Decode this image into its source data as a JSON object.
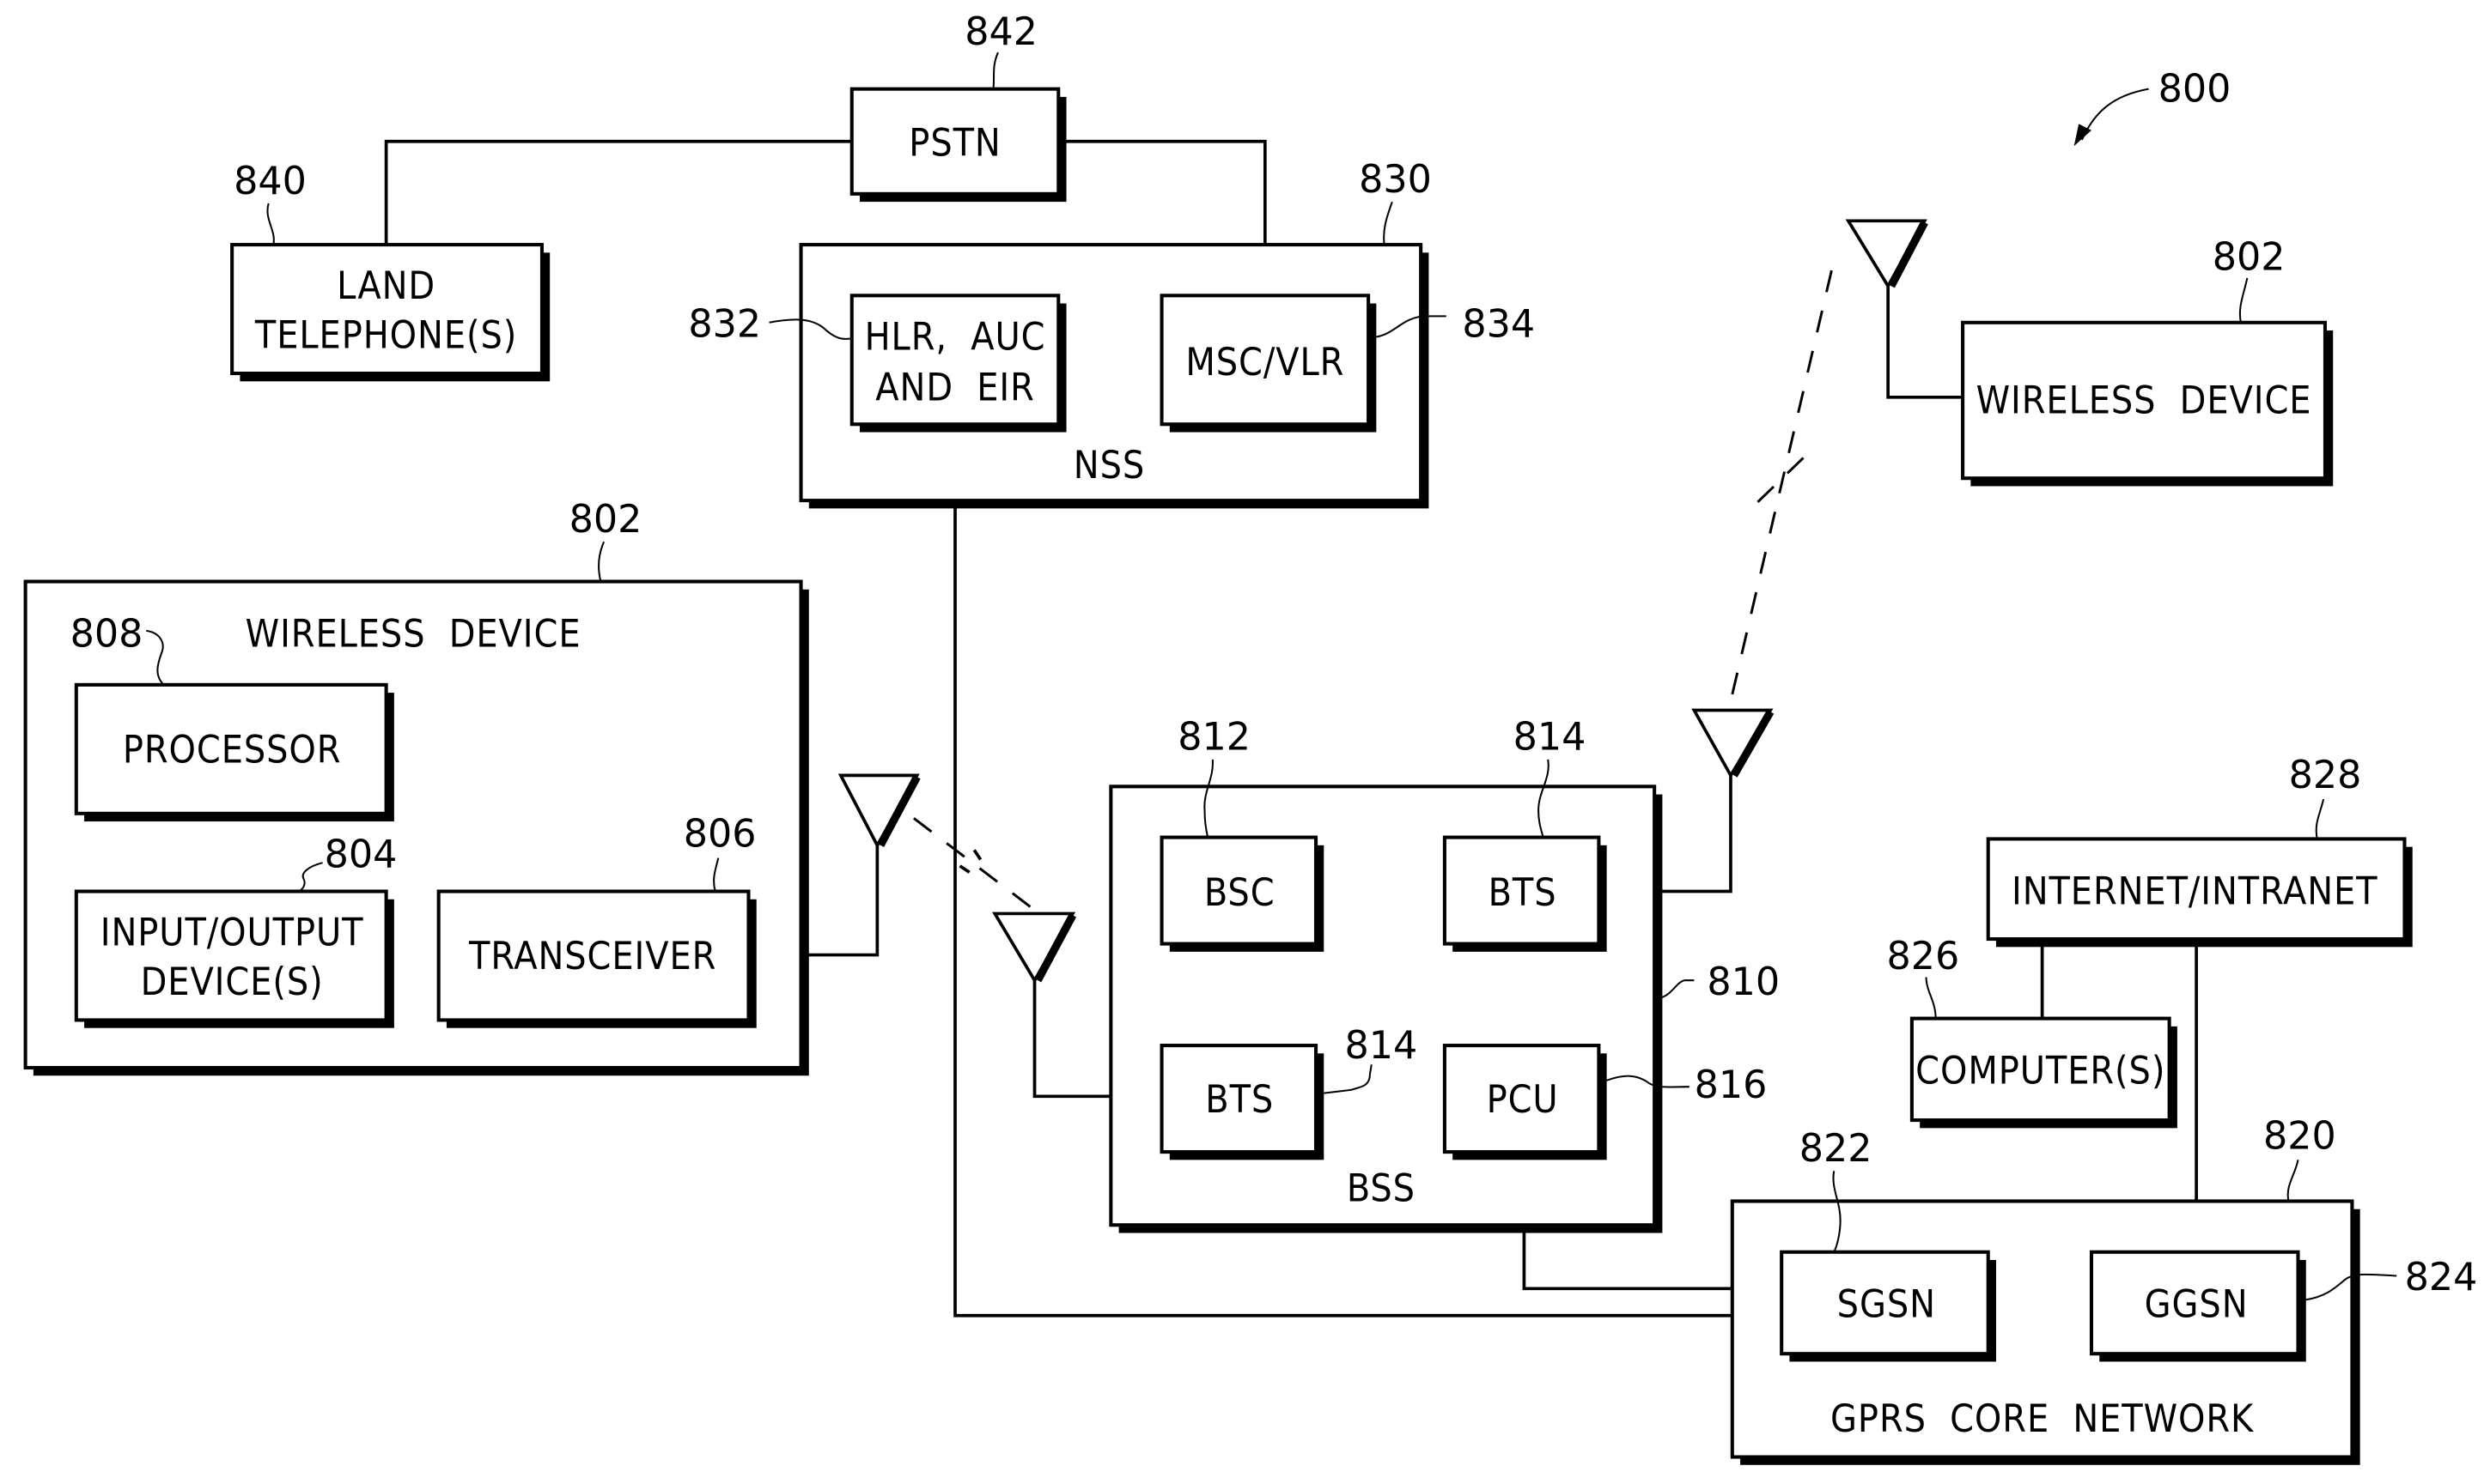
{
  "figure": {
    "reference": "800",
    "title_pointer": "800"
  },
  "nodes": {
    "pstn": {
      "label": "PSTN",
      "ref": "842"
    },
    "land_telephone": {
      "label_line1": "LAND",
      "label_line2": "TELEPHONE(S)",
      "ref": "840"
    },
    "nss": {
      "label": "NSS",
      "ref": "830"
    },
    "hlr": {
      "label_line1": "HLR,  AUC",
      "label_line2": "AND  EIR",
      "ref": "832"
    },
    "msc": {
      "label": "MSC/VLR",
      "ref": "834"
    },
    "wireless_device_right": {
      "label": "WIRELESS  DEVICE",
      "ref": "802"
    },
    "wireless_device_left": {
      "label": "WIRELESS  DEVICE",
      "ref": "802"
    },
    "processor": {
      "label": "PROCESSOR",
      "ref": "808"
    },
    "io_device": {
      "label_line1": "INPUT/OUTPUT",
      "label_line2": "DEVICE(S)",
      "ref": "804"
    },
    "transceiver": {
      "label": "TRANSCEIVER",
      "ref": "806"
    },
    "bss": {
      "label": "BSS",
      "ref": "810"
    },
    "bsc": {
      "label": "BSC",
      "ref": "812"
    },
    "bts_top": {
      "label": "BTS",
      "ref": "814"
    },
    "bts_bottom": {
      "label": "BTS",
      "ref": "814"
    },
    "pcu": {
      "label": "PCU",
      "ref": "816"
    },
    "internet": {
      "label": "INTERNET/INTRANET",
      "ref": "828"
    },
    "computers": {
      "label": "COMPUTER(S)",
      "ref": "826"
    },
    "gprs": {
      "label": "GPRS  CORE  NETWORK",
      "ref": "820"
    },
    "sgsn": {
      "label": "SGSN",
      "ref": "822"
    },
    "ggsn": {
      "label": "GGSN",
      "ref": "824"
    }
  },
  "connections": [
    {
      "from": "land_telephone",
      "to": "pstn"
    },
    {
      "from": "pstn",
      "to": "msc"
    },
    {
      "from": "hlr",
      "to": "msc"
    },
    {
      "from": "hlr",
      "to": "sgsn"
    },
    {
      "from": "processor",
      "to": "io_device"
    },
    {
      "from": "processor",
      "to": "transceiver"
    },
    {
      "from": "transceiver",
      "to": "antenna"
    },
    {
      "from": "bsc",
      "to": "bts_top"
    },
    {
      "from": "bsc",
      "to": "bts_bottom"
    },
    {
      "from": "bsc",
      "to": "pcu"
    },
    {
      "from": "bts_top",
      "to": "antenna"
    },
    {
      "from": "bts_bottom",
      "to": "antenna"
    },
    {
      "from": "pcu",
      "to": "sgsn"
    },
    {
      "from": "sgsn",
      "to": "ggsn"
    },
    {
      "from": "internet",
      "to": "computers"
    },
    {
      "from": "internet",
      "to": "ggsn"
    },
    {
      "from": "wireless_device_right",
      "to": "antenna"
    }
  ],
  "wireless_links": [
    {
      "between": [
        "wireless_device_left",
        "bts_bottom"
      ],
      "style": "dashed"
    },
    {
      "between": [
        "bts_top",
        "wireless_device_right"
      ],
      "style": "dashed"
    }
  ]
}
